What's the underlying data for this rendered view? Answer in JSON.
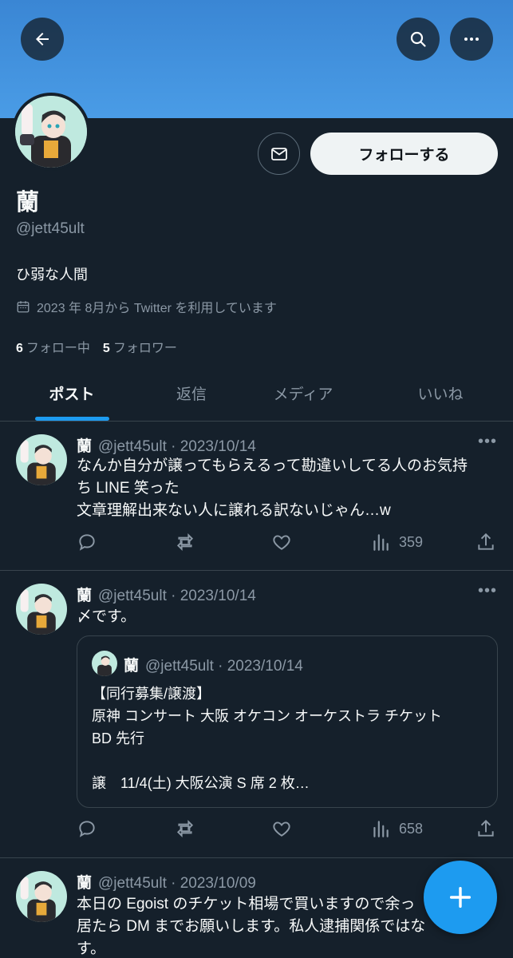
{
  "colors": {
    "background": "#15202b",
    "banner": "#4a9ce6",
    "accent": "#1d9bf0",
    "muted": "#8b98a5"
  },
  "header": {
    "back_icon": "arrow-left-icon",
    "search_icon": "search-icon",
    "more_icon": "more-horizontal-icon"
  },
  "profile": {
    "name": "蘭",
    "handle": "@jett45ult",
    "bio": "ひ弱な人間",
    "joined": "2023 年 8月から Twitter を利用しています",
    "following_count": "6",
    "following_label": "フォロー中",
    "followers_count": "5",
    "followers_label": "フォロワー",
    "follow_button": "フォローする"
  },
  "tabs": [
    {
      "label": "ポスト",
      "active": true
    },
    {
      "label": "返信",
      "active": false
    },
    {
      "label": "メディア",
      "active": false
    },
    {
      "label": "いいね",
      "active": false
    }
  ],
  "tweets": [
    {
      "name": "蘭",
      "meta": "@jett45ult · 2023/10/14",
      "text_lines": [
        "なんか自分が譲ってもらえるって勘違いしてる人のお気持",
        "ち LINE 笑った",
        "文章理解出来ない人に譲れる訳ないじゃん…w"
      ],
      "views": "359"
    },
    {
      "name": "蘭",
      "meta": "@jett45ult · 2023/10/14",
      "text_lines": [
        "〆です。"
      ],
      "views": "658",
      "quote": {
        "name": "蘭",
        "meta": "@jett45ult · 2023/10/14",
        "text": "【同行募集/譲渡】\n原神 コンサート 大阪 オケコン オーケストラ チケット\nBD 先行\n\n譲　11/4(土) 大阪公演 S 席 2 枚…"
      }
    },
    {
      "name": "蘭",
      "meta": "@jett45ult · 2023/10/09",
      "text_lines": [
        "本日の Egoist のチケット相場で買いますので余っ",
        "居たら DM までお願いします。私人逮捕関係ではな",
        "す。"
      ]
    }
  ],
  "fab": {
    "icon": "plus-icon"
  }
}
